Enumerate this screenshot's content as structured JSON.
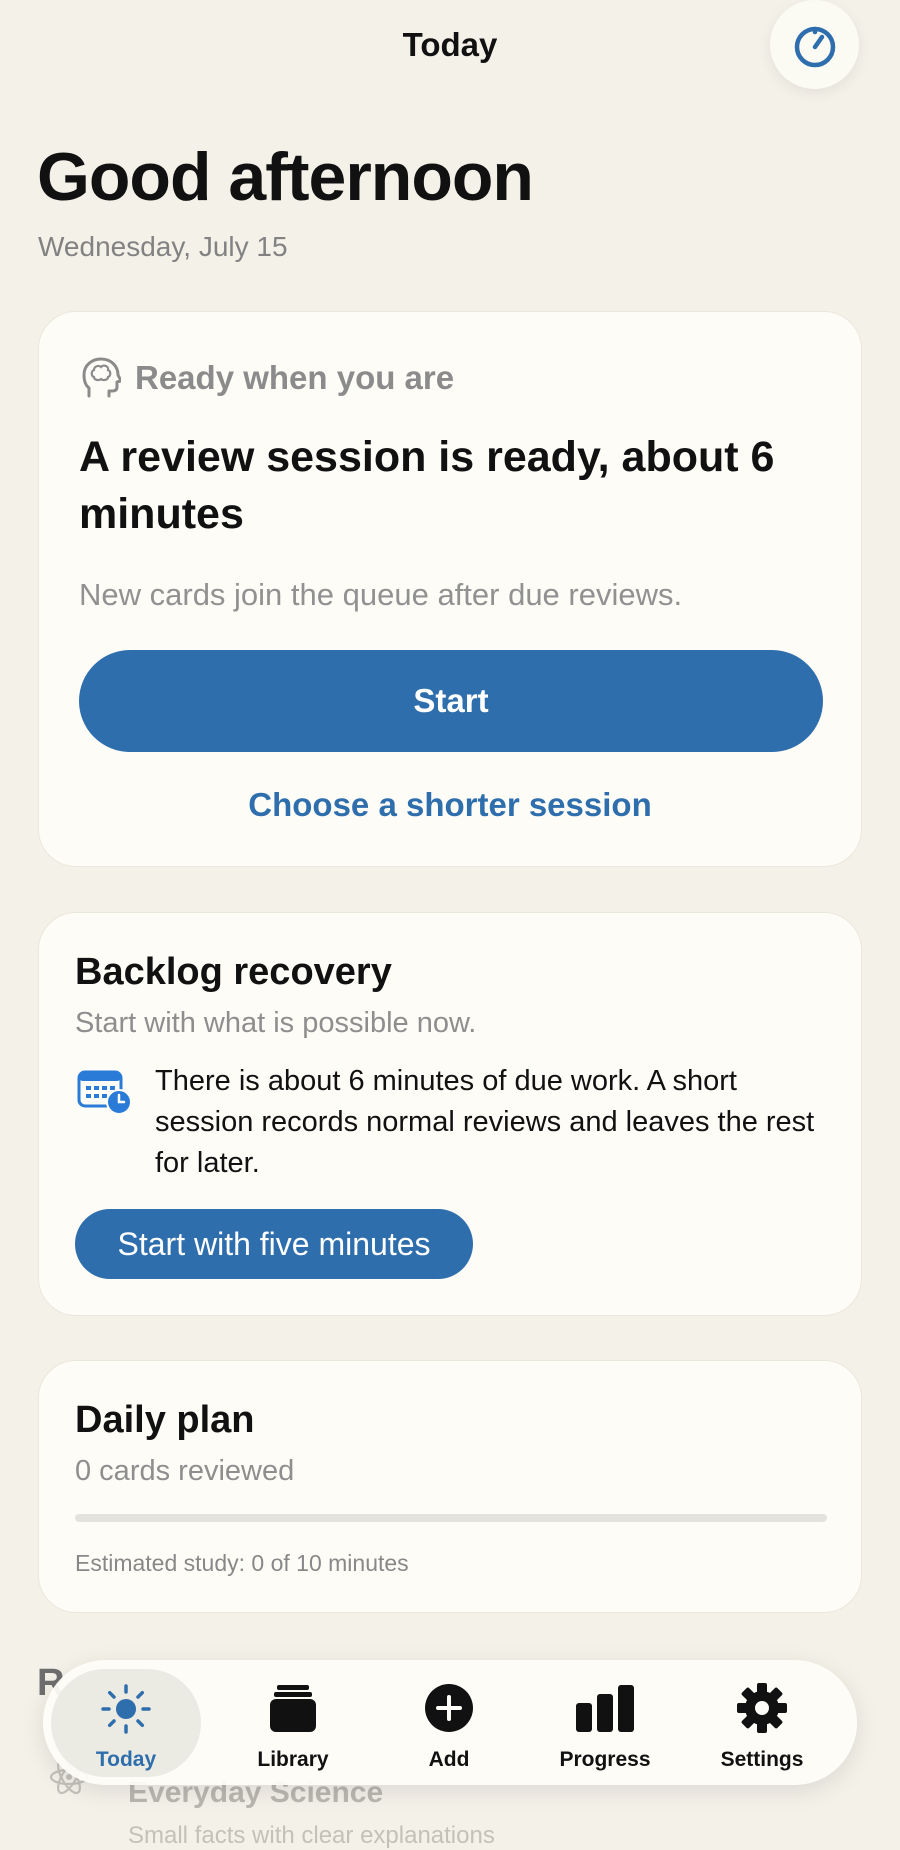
{
  "header": {
    "title": "Today",
    "timer_icon": "timer-icon"
  },
  "greeting": {
    "title": "Good afternoon",
    "date": "Wednesday, July 15"
  },
  "review_card": {
    "label": "Ready when you are",
    "icon": "brain-head-icon",
    "headline": "A review session is ready, about 6 minutes",
    "subtitle": "New cards join the queue after due reviews.",
    "start_label": "Start",
    "shorter_label": "Choose a shorter session"
  },
  "backlog_card": {
    "title": "Backlog recovery",
    "subtitle": "Start with what is possible now.",
    "icon": "calendar-clock-icon",
    "info": "There is about 6 minutes of due work. A short session records normal reviews and leaves the rest for later.",
    "button_label": "Start with five minutes"
  },
  "daily_plan": {
    "title": "Daily plan",
    "cards_reviewed": "0 cards reviewed",
    "progress": 0,
    "estimate": "Estimated study: 0 of 10 minutes"
  },
  "recent_decks": {
    "heading_partial": "R",
    "deck_title": "Everyday Science",
    "deck_subtitle": "Small facts with clear explanations",
    "deck_icon": "atom-icon"
  },
  "tabbar": {
    "items": [
      {
        "label": "Today",
        "icon": "sun-icon",
        "active": true
      },
      {
        "label": "Library",
        "icon": "cards-stack-icon",
        "active": false
      },
      {
        "label": "Add",
        "icon": "plus-circle-icon",
        "active": false
      },
      {
        "label": "Progress",
        "icon": "bar-chart-icon",
        "active": false
      },
      {
        "label": "Settings",
        "icon": "gear-icon",
        "active": false
      }
    ]
  },
  "colors": {
    "accent": "#2f6ead",
    "background": "#f4f1e9",
    "card": "#fdfcf7"
  }
}
